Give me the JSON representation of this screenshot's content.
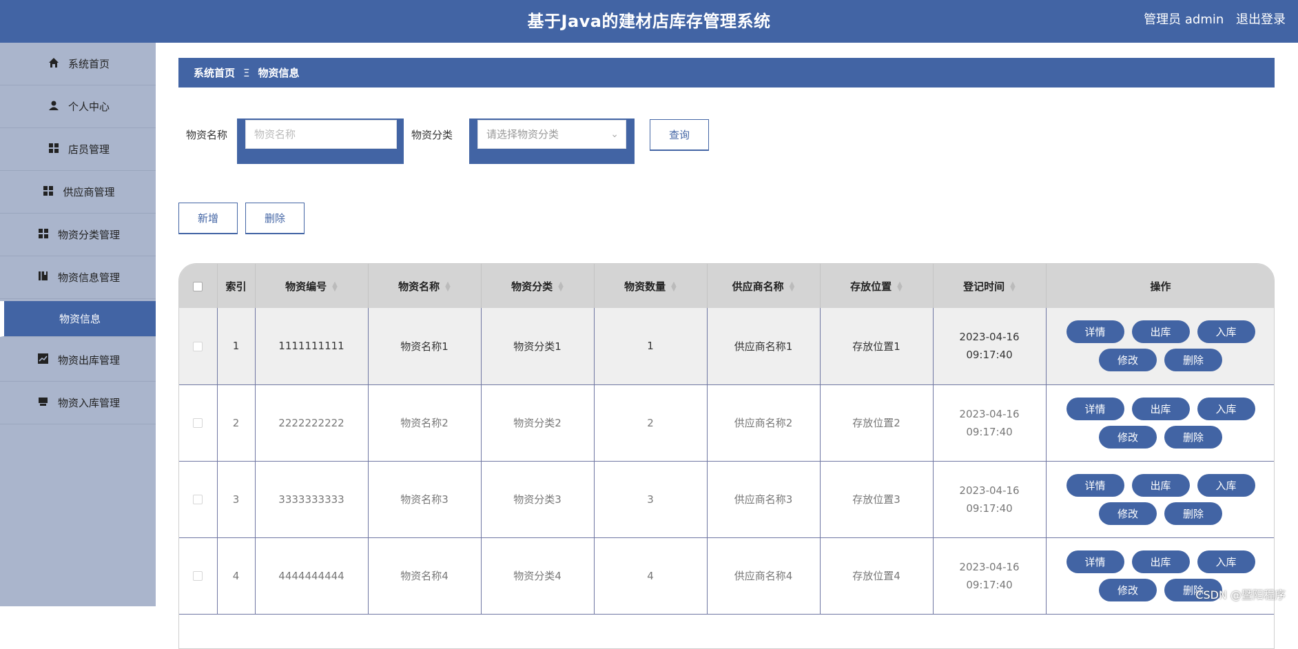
{
  "app": {
    "title": "基于Java的建材店库存管理系统"
  },
  "user": {
    "role_name": "管理员 admin",
    "logout": "退出登录"
  },
  "sidebar": {
    "items": [
      {
        "label": "系统首页",
        "icon": "home-icon"
      },
      {
        "label": "个人中心",
        "icon": "user-icon"
      },
      {
        "label": "店员管理",
        "icon": "grid-icon"
      },
      {
        "label": "供应商管理",
        "icon": "grid-icon"
      },
      {
        "label": "物资分类管理",
        "icon": "grid-icon"
      },
      {
        "label": "物资信息管理",
        "icon": "book-icon"
      },
      {
        "label": "物资信息",
        "icon": "",
        "active": true
      },
      {
        "label": "物资出库管理",
        "icon": "chart-icon"
      },
      {
        "label": "物资入库管理",
        "icon": "box-icon"
      }
    ]
  },
  "breadcrumb": {
    "home": "系统首页",
    "separator": "Ξ",
    "current": "物资信息"
  },
  "search": {
    "name_label": "物资名称",
    "name_placeholder": "物资名称",
    "category_label": "物资分类",
    "category_placeholder": "请选择物资分类",
    "query_button": "查询"
  },
  "actions": {
    "add": "新增",
    "delete": "删除"
  },
  "table": {
    "columns": [
      "索引",
      "物资编号",
      "物资名称",
      "物资分类",
      "物资数量",
      "供应商名称",
      "存放位置",
      "登记时间",
      "操作"
    ],
    "rows": [
      {
        "index": "1",
        "code": "1111111111",
        "name": "物资名称1",
        "category": "物资分类1",
        "qty": "1",
        "supplier": "供应商名称1",
        "location": "存放位置1",
        "time": "2023-04-16 09:17:40"
      },
      {
        "index": "2",
        "code": "2222222222",
        "name": "物资名称2",
        "category": "物资分类2",
        "qty": "2",
        "supplier": "供应商名称2",
        "location": "存放位置2",
        "time": "2023-04-16 09:17:40"
      },
      {
        "index": "3",
        "code": "3333333333",
        "name": "物资名称3",
        "category": "物资分类3",
        "qty": "3",
        "supplier": "供应商名称3",
        "location": "存放位置3",
        "time": "2023-04-16 09:17:40"
      },
      {
        "index": "4",
        "code": "4444444444",
        "name": "物资名称4",
        "category": "物资分类4",
        "qty": "4",
        "supplier": "供应商名称4",
        "location": "存放位置4",
        "time": "2023-04-16 09:17:40"
      }
    ],
    "row_actions": {
      "detail": "详情",
      "out": "出库",
      "in": "入库",
      "edit": "修改",
      "delete": "删除"
    }
  },
  "watermark": "CSDN @暨阳程序",
  "colors": {
    "primary": "#4264a4",
    "sidebar": "#aab5cc"
  }
}
